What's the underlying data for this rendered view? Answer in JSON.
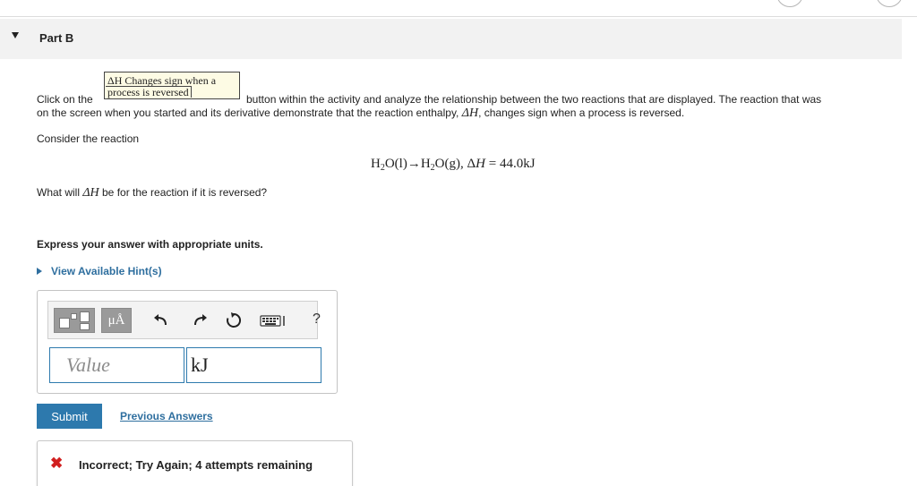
{
  "part": {
    "title": "Part B"
  },
  "instruction": {
    "prefix": "Click on the",
    "button_line1": "ΔH Changes sign when a",
    "button_line2": "process is reversed",
    "suffix_line1": "button within the activity and analyze the relationship between the two reactions that are displayed. The reaction that was",
    "line2_before": "on the screen when you started and its derivative demonstrate that the reaction enthalpy, ",
    "line2_symbol": "ΔH",
    "line2_after": ", changes sign when a process is reversed."
  },
  "consider": {
    "text": "Consider the reaction"
  },
  "equation": {
    "h1": "H",
    "s1": "2",
    "p1": "O(l)→H",
    "s2": "2",
    "p2": "O(g), Δ",
    "h2": "H",
    "p3": " = 44.0kJ"
  },
  "question": {
    "before": "What will ",
    "symbol": "ΔH",
    "after": " be for the reaction if it is reversed?"
  },
  "express": {
    "text": "Express your answer with appropriate units."
  },
  "hints": {
    "label": "View Available Hint(s)"
  },
  "answer": {
    "toolbar": {
      "units_label": "μÅ",
      "help_label": "?"
    },
    "value_placeholder": "Value",
    "units_value": "kJ"
  },
  "actions": {
    "submit_label": "Submit",
    "previous_label": "Previous Answers"
  },
  "feedback": {
    "icon": "✖",
    "message": "Incorrect; Try Again; 4 attempts remaining"
  }
}
